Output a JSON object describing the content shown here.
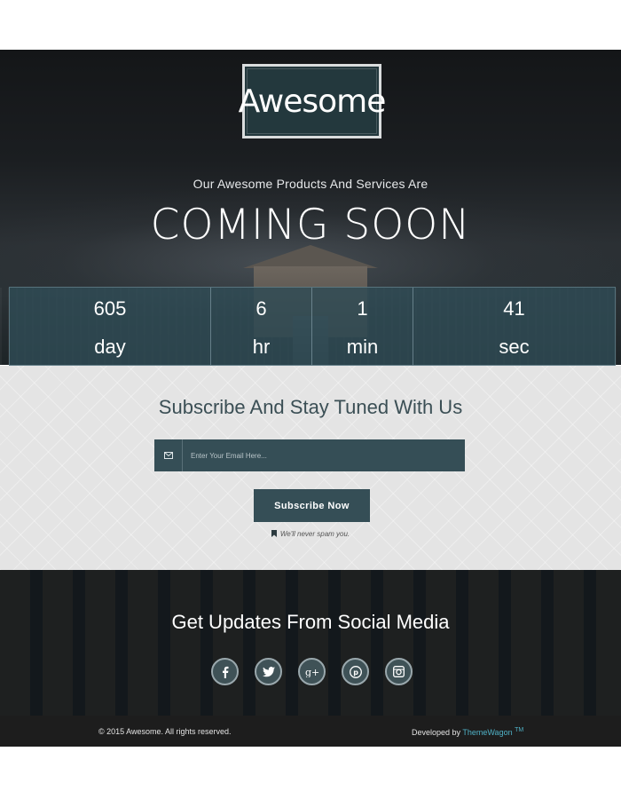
{
  "hero": {
    "logo_text": "Awesome",
    "tagline": "Our Awesome Products And Services Are",
    "headline": "COMING SOON"
  },
  "countdown": [
    {
      "value": "605",
      "label": "day"
    },
    {
      "value": "6",
      "label": "hr"
    },
    {
      "value": "1",
      "label": "min"
    },
    {
      "value": "41",
      "label": "sec"
    }
  ],
  "subscribe": {
    "title": "Subscribe And Stay Tuned With Us",
    "email_placeholder": "Enter Your Email Here...",
    "button_label": "Subscribe Now",
    "spam_note": "We'll never spam you."
  },
  "social": {
    "title": "Get Updates From Social Media",
    "icons": [
      "facebook-icon",
      "twitter-icon",
      "google-plus-icon",
      "pinterest-icon",
      "instagram-icon"
    ]
  },
  "footer": {
    "copyright": "© 2015 Awesome. All rights reserved.",
    "developed_by_prefix": "Developed by",
    "developer_name": "ThemeWagon",
    "trademark": "TM"
  },
  "colors": {
    "primary": "#354e56",
    "accent_link": "#4fb1c6"
  }
}
